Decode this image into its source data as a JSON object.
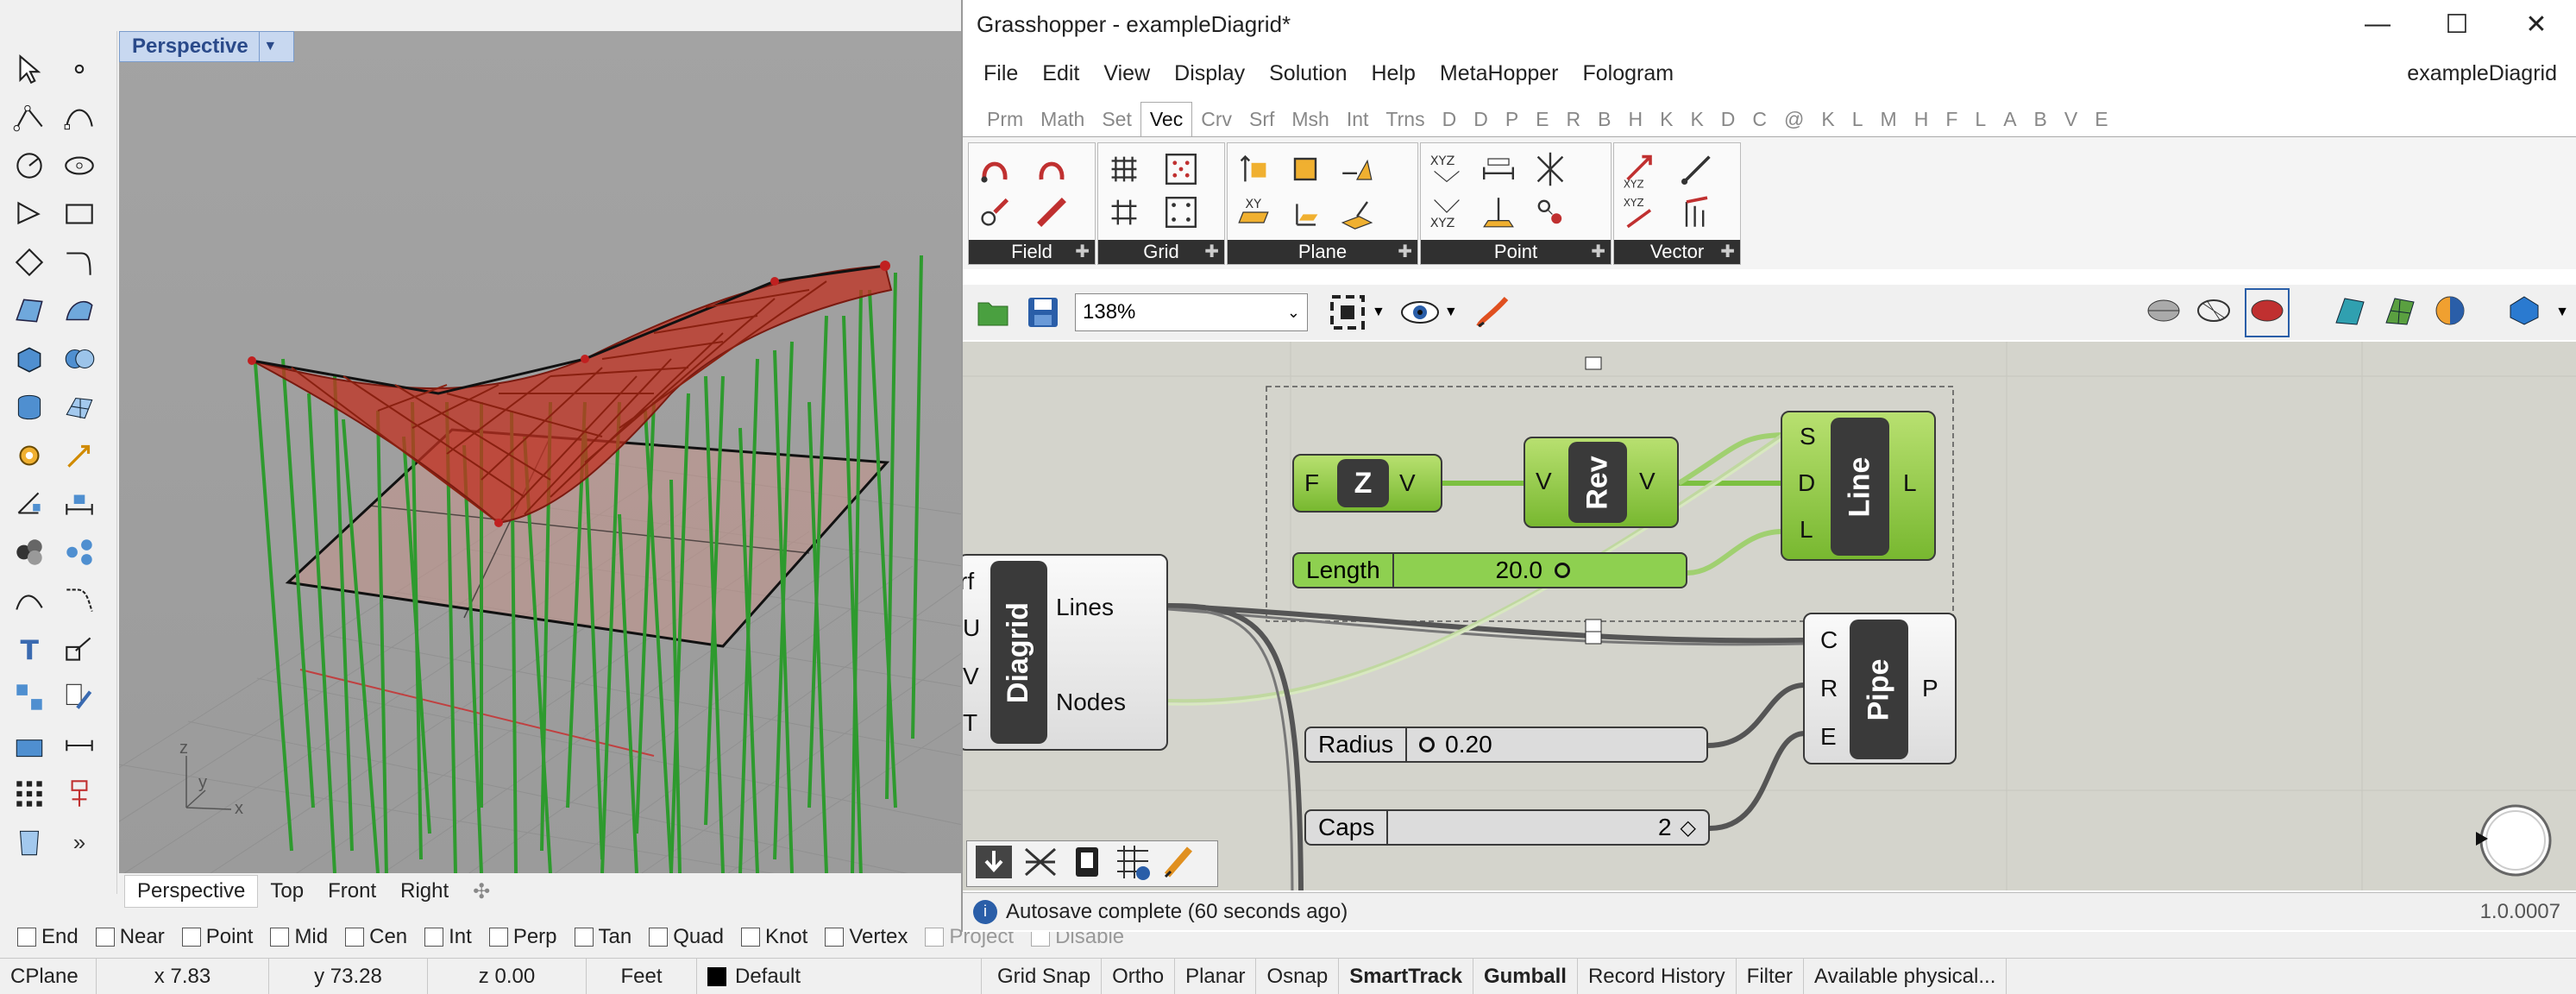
{
  "rhino": {
    "viewport_title": "Perspective",
    "view_tabs": [
      "Perspective",
      "Top",
      "Front",
      "Right"
    ],
    "view_tab_add": "✣",
    "axis": {
      "z": "z",
      "y": "y",
      "x": "x"
    },
    "osnaps": [
      "End",
      "Near",
      "Point",
      "Mid",
      "Cen",
      "Int",
      "Perp",
      "Tan",
      "Quad",
      "Knot",
      "Vertex",
      "Project",
      "Disable"
    ],
    "status": {
      "cplane": "CPlane",
      "x": "x 7.83",
      "y": "y 73.28",
      "z": "z 0.00",
      "units": "Feet",
      "layer": "Default",
      "toggles": [
        "Grid Snap",
        "Ortho",
        "Planar",
        "Osnap",
        "SmartTrack",
        "Gumball",
        "Record History",
        "Filter",
        "Available physical..."
      ]
    },
    "toolbar_more": "»"
  },
  "gh": {
    "title": "Grasshopper - exampleDiagrid*",
    "menu": [
      "File",
      "Edit",
      "View",
      "Display",
      "Solution",
      "Help",
      "MetaHopper",
      "Fologram"
    ],
    "doc_name": "exampleDiagrid",
    "tabs": [
      "Prm",
      "Math",
      "Set",
      "Vec",
      "Crv",
      "Srf",
      "Msh",
      "Int",
      "Trns",
      "D",
      "D",
      "P",
      "E",
      "R",
      "B",
      "H",
      "K",
      "K",
      "D",
      "C",
      "@",
      "K",
      "L",
      "M",
      "H",
      "F",
      "L",
      "A",
      "B",
      "V",
      "E"
    ],
    "active_tab": "Vec",
    "ribbon_groups": [
      "Field",
      "Grid",
      "Plane",
      "Point",
      "Vector"
    ],
    "zoom": "138%",
    "status": "Autosave complete (60 seconds ago)",
    "version": "1.0.0007",
    "components": {
      "unit_z": {
        "name": "Z",
        "in": "F",
        "out": "V"
      },
      "reverse": {
        "name": "Rev",
        "in": "V",
        "out": "V"
      },
      "line": {
        "name": "Line",
        "inputs": [
          "S",
          "D",
          "L"
        ],
        "out": "L"
      },
      "diagrid": {
        "name": "Diagrid",
        "inputs": [
          "rf",
          "U",
          "V",
          "T"
        ],
        "outputs": [
          "Lines",
          "Nodes"
        ]
      },
      "pipe": {
        "name": "Pipe",
        "inputs": [
          "C",
          "R",
          "E"
        ],
        "out": "P"
      }
    },
    "sliders": {
      "length": {
        "label": "Length",
        "value": "20.0"
      },
      "radius": {
        "label": "Radius",
        "value": "0.20"
      },
      "caps": {
        "label": "Caps",
        "value": "2"
      }
    }
  }
}
